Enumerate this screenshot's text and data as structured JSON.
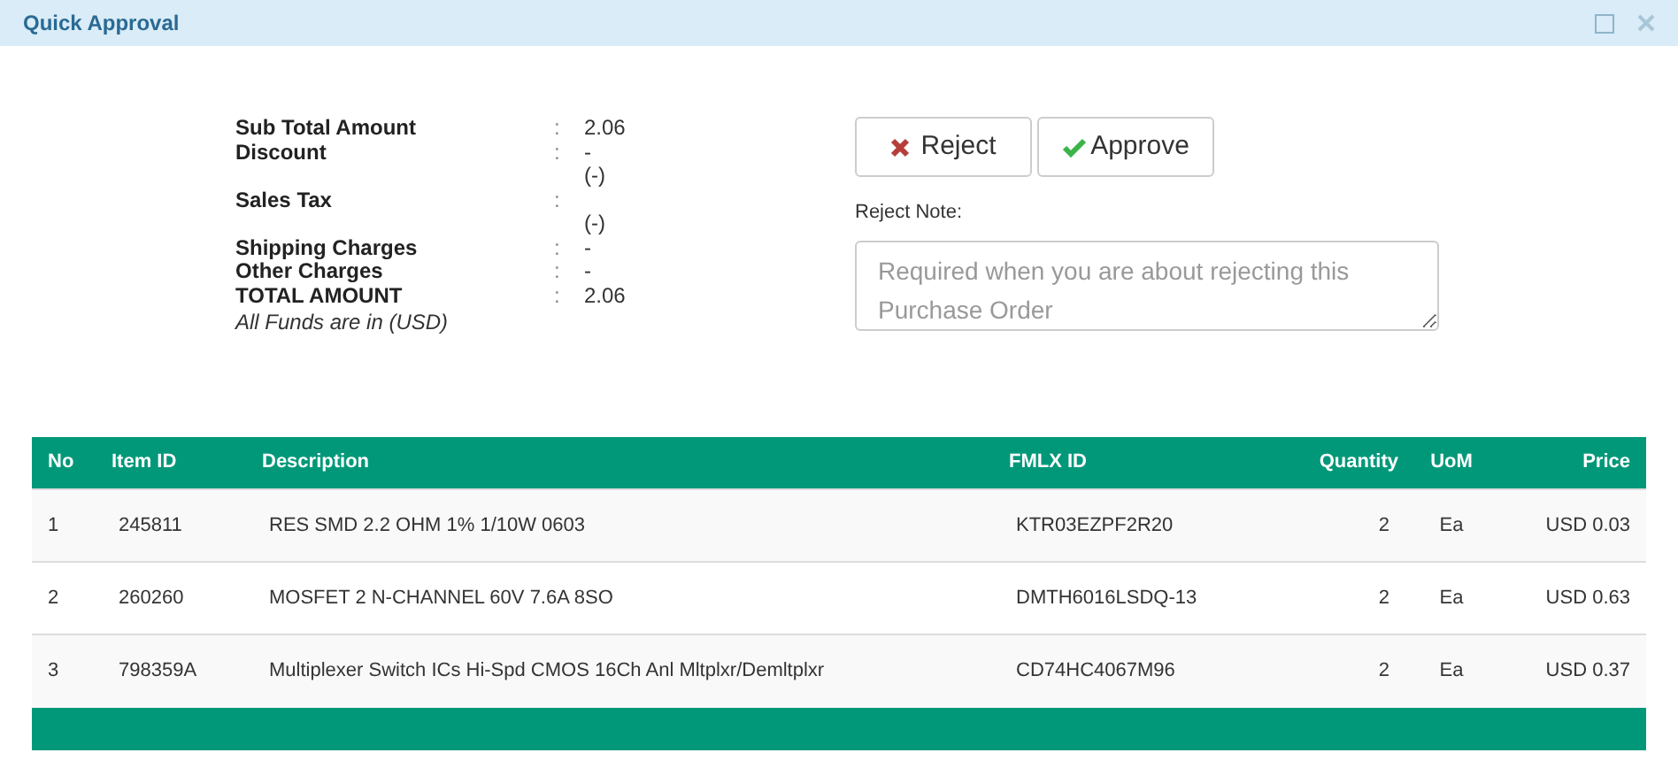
{
  "window": {
    "title": "Quick Approval"
  },
  "summary": {
    "rows": [
      {
        "label": "Sub Total Amount",
        "separator": ":",
        "value": "2.06"
      },
      {
        "label": "Discount",
        "separator": ":",
        "value": "-"
      },
      {
        "value": "(-)"
      },
      {
        "label": "Sales Tax",
        "separator": ":"
      },
      {
        "value": "(-)"
      },
      {
        "label": "Shipping Charges",
        "separator": ":",
        "value": "-"
      },
      {
        "label": "Other Charges",
        "separator": ":",
        "value": "-"
      },
      {
        "label": "TOTAL AMOUNT",
        "separator": ":",
        "value": "2.06"
      }
    ],
    "note": "All Funds are in (USD)"
  },
  "buttons": [
    {
      "kind": "reject",
      "label": "Reject"
    },
    {
      "kind": "approve",
      "label": "Approve"
    }
  ],
  "reject_note": {
    "label": "Reject Note:",
    "placeholder": "Required when you are about rejecting this Purchase Order"
  },
  "table": {
    "columns": [
      "No",
      "Item ID",
      "Description",
      "FMLX ID",
      "Quantity",
      "UoM",
      "Price"
    ],
    "rows": [
      [
        "1",
        "245811",
        "RES SMD 2.2 OHM 1% 1/10W 0603",
        "KTR03EZPF2R20",
        "2",
        "Ea",
        "USD 0.03"
      ],
      [
        "2",
        "260260",
        "MOSFET 2 N-CHANNEL 60V 7.6A 8SO",
        "DMTH6016LSDQ-13",
        "2",
        "Ea",
        "USD 0.63"
      ],
      [
        "3",
        "798359A",
        "Multiplexer Switch ICs Hi-Spd CMOS 16Ch Anl Mltplxr/Demltplxr",
        "CD74HC4067M96",
        "2",
        "Ea",
        "USD 0.37"
      ]
    ]
  }
}
